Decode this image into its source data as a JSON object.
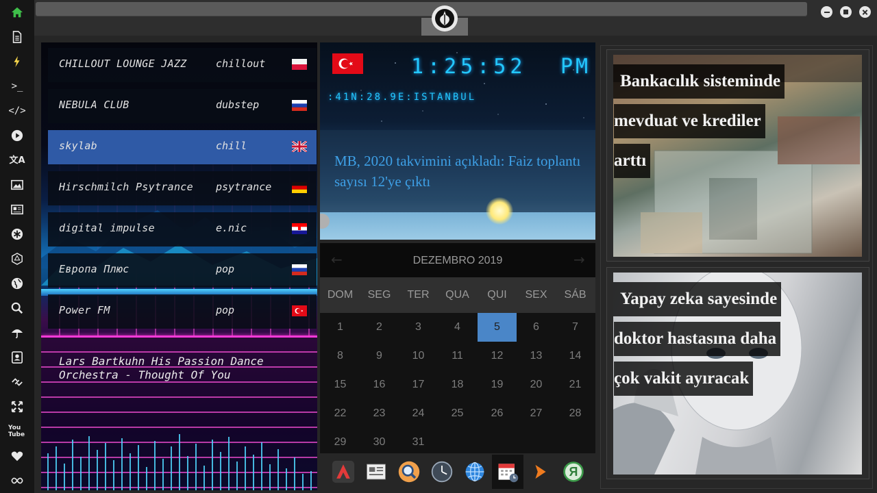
{
  "sidebar": {
    "icons": [
      "home-icon",
      "document-icon",
      "bolt-icon",
      "terminal-icon",
      "code-icon",
      "play-icon",
      "translate-icon",
      "image-icon",
      "newspaper-icon",
      "asterisk-icon",
      "hexagon-icon",
      "globe-icon",
      "search-icon",
      "umbrella-icon",
      "contact-card-icon",
      "link-icon",
      "expand-icon",
      "youtube-icon",
      "heart-icon",
      "infinity-icon"
    ],
    "youtube_text": "You Tube",
    "accent": "#3fbf4a"
  },
  "radio": {
    "stations": [
      {
        "name": "CHILLOUT LOUNGE JAZZ",
        "genre": "chillout",
        "flag": "poland-flag"
      },
      {
        "name": "NEBULA CLUB",
        "genre": "dubstep",
        "flag": "russia-flag"
      },
      {
        "name": "skylab",
        "genre": "chill",
        "flag": "uk-flag"
      },
      {
        "name": "Hirschmilch Psytrance",
        "genre": "psytrance",
        "flag": "germany-flag"
      },
      {
        "name": "digital impulse",
        "genre": "e.nic",
        "flag": "croatia-flag"
      },
      {
        "name": "Европа Плюс",
        "genre": "pop",
        "flag": "russia-flag"
      },
      {
        "name": "Power FM",
        "genre": "pop",
        "flag": "turkey-flag"
      }
    ],
    "selected_index": 2,
    "now_playing": "Lars Bartkuhn His Passion Dance Orchestra - Thought Of You",
    "selected_color": "#2f5aa6"
  },
  "clock": {
    "time": "1:25:52",
    "ampm": "PM",
    "location": ":41N:28.9E:ISTANBUL",
    "flag": "turkey-flag",
    "headline": "MB, 2020 takvimini açıkladı: Faiz toplantı sayısı 12'ye çıktı",
    "digit_color": "#23c8ff"
  },
  "calendar": {
    "title": "DEZEMBRO 2019",
    "weekdays": [
      "DOM",
      "SEG",
      "TER",
      "QUA",
      "QUI",
      "SEX",
      "SÁB"
    ],
    "weeks": [
      [
        "1",
        "2",
        "3",
        "4",
        "5",
        "6",
        "7"
      ],
      [
        "8",
        "9",
        "10",
        "11",
        "12",
        "13",
        "14"
      ],
      [
        "15",
        "16",
        "17",
        "18",
        "19",
        "20",
        "21"
      ],
      [
        "22",
        "23",
        "24",
        "25",
        "26",
        "27",
        "28"
      ],
      [
        "29",
        "30",
        "31",
        "",
        "",
        "",
        ""
      ]
    ],
    "today": "5",
    "highlight_color": "#4a86c8"
  },
  "dock": {
    "icons": [
      "arch-icon",
      "news-app-icon",
      "search-app-icon",
      "clock-app-icon",
      "globe-app-icon",
      "calendar-app-icon",
      "arrow-app-icon",
      "yandex-icon"
    ],
    "yandex_letter": "Я"
  },
  "news": {
    "cards": [
      {
        "lines": [
          "Bankacılık sisteminde",
          "mevduat ve krediler",
          "arttı"
        ],
        "image": "banknotes-image"
      },
      {
        "lines": [
          "Yapay zeka sayesinde",
          "doktor hastasına daha",
          "çok vakit ayıracak"
        ],
        "image": "robot-image"
      }
    ]
  }
}
